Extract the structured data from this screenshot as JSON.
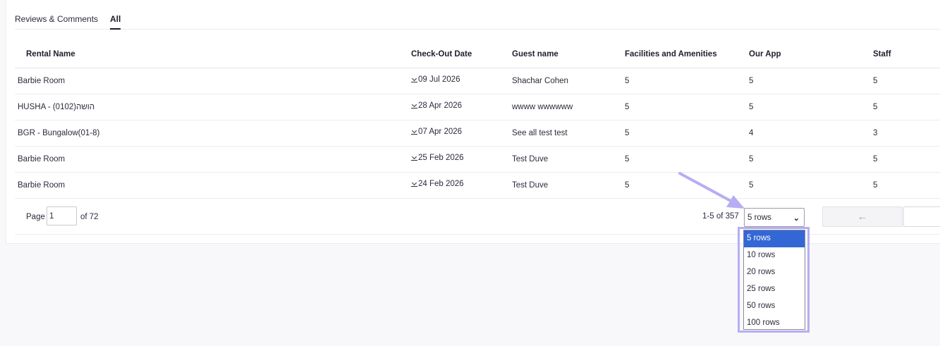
{
  "tabs": [
    "Reviews & Comments",
    "All"
  ],
  "table": {
    "columns": [
      "Rental Name",
      "Check-Out Date",
      "Guest name",
      "Facilities and Amenities",
      "Our App",
      "Staff"
    ],
    "rows": [
      [
        "Barbie Room",
        "09 Jul 2026",
        "Shachar Cohen",
        "5",
        "5",
        "5"
      ],
      [
        "HUSHA - (0102)הושה",
        "28 Apr 2026",
        "wwww wwwwww",
        "5",
        "5",
        "5"
      ],
      [
        "BGR - Bungalow(01-8)",
        "07 Apr 2026",
        "See all test test",
        "5",
        "4",
        "3"
      ],
      [
        "Barbie Room",
        "25 Feb 2026",
        "Test Duve",
        "5",
        "5",
        "5"
      ],
      [
        "Barbie Room",
        "24 Feb 2026",
        "Test Duve",
        "5",
        "5",
        "5"
      ]
    ]
  },
  "pagination": {
    "page_label": "Page",
    "page_value": "1",
    "of_label": "of 72",
    "range_label": "1-5 of 357",
    "rows_selected": "5 rows",
    "rows_options": [
      "5 rows",
      "10 rows",
      "20 rows",
      "25 rows",
      "50 rows",
      "100 rows"
    ],
    "prev_arrow": "←",
    "next_arrow": "→"
  },
  "colors": {
    "selected_option": "#3367d6",
    "annotation": "#b6aef2"
  },
  "icons": {
    "download": "download-icon",
    "columns": "columns-icon",
    "chevron": "chevron-down-icon"
  }
}
